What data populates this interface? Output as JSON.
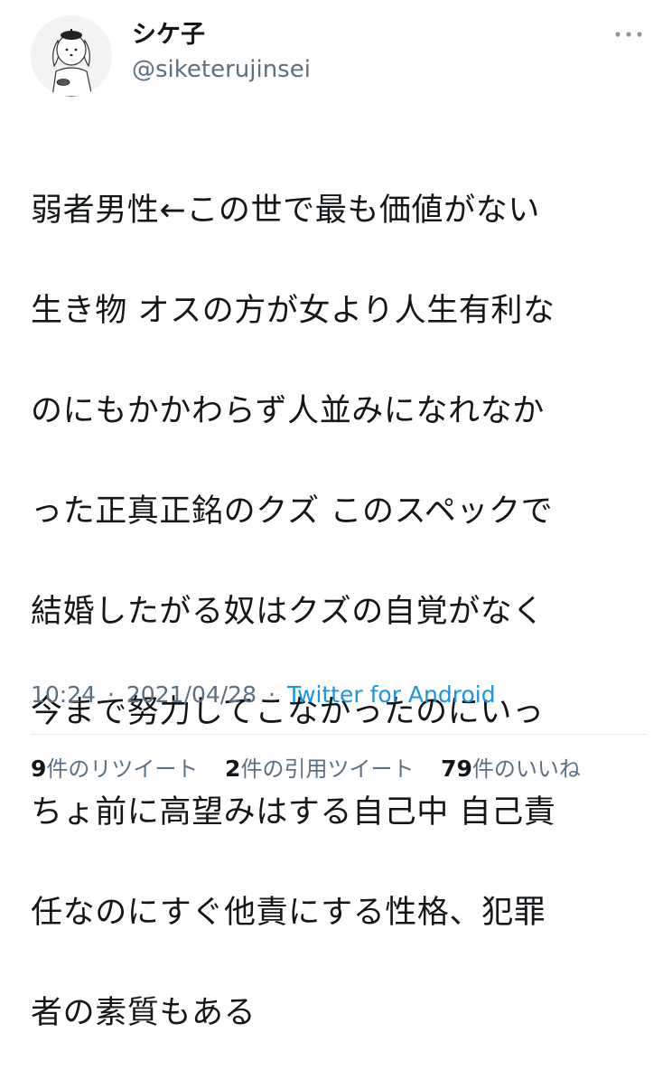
{
  "tweet": {
    "display_name": "シケ子",
    "handle": "@siketerujinsei",
    "avatar_icon": "dog-avatar-icon",
    "more_icon": "more-dots-icon",
    "text_lines": [
      "弱者男性←この世で最も価値がない",
      "生き物 オスの方が女より人生有利な",
      "のにもかかわらず人並みになれなか",
      "った正真正銘のクズ このスペックで",
      "結婚したがる奴はクズの自覚がなく",
      "今まで努力してこなかったのにいっ",
      "ちょ前に高望みはする自己中 自己責",
      "任なのにすぐ他責にする性格、犯罪",
      "者の素質もある"
    ],
    "time": "10:24",
    "date": "2021/04/28",
    "separator": "·",
    "source": "Twitter for Android"
  },
  "stats": {
    "retweets": {
      "count": "9",
      "label": "件のリツイート"
    },
    "quotes": {
      "count": "2",
      "label": "件の引用ツイート"
    },
    "likes": {
      "count": "79",
      "label": "件のいいね"
    }
  },
  "colors": {
    "text": "#14171a",
    "secondary": "#5b7083",
    "link": "#1b95e0",
    "divider": "#e1e8ed"
  }
}
